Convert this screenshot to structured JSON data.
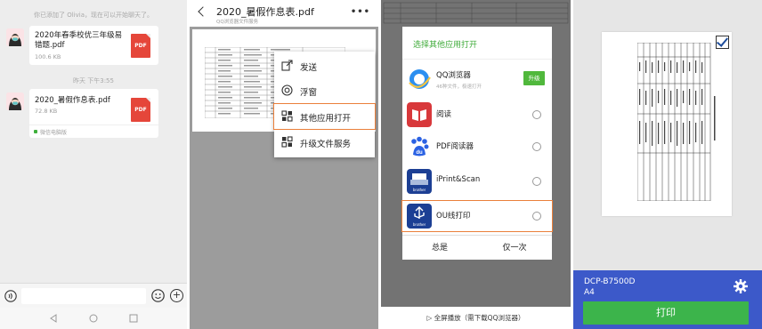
{
  "chat": {
    "system_message": "你已添加了 Olivia，现在可以开始聊天了。",
    "timestamp": "昨天 下午3:55",
    "messages": [
      {
        "file_name": "2020年春季校优三年级易错题.pdf",
        "file_size": "100.6 KB",
        "file_type": "PDF"
      },
      {
        "file_name": "2020_暑假作息表.pdf",
        "file_size": "72.8 KB",
        "file_type": "PDF",
        "source": "微信电脑版"
      }
    ]
  },
  "viewer": {
    "title": "2020_暑假作息表.pdf",
    "subtitle": "QQ浏览器文件服务",
    "more_icon": "more-dots-icon",
    "menu": [
      {
        "label": "发送",
        "icon": "send-icon"
      },
      {
        "label": "浮窗",
        "icon": "float-window-icon"
      },
      {
        "label": "其他应用打开",
        "icon": "apps-grid-icon",
        "highlighted": true
      },
      {
        "label": "升级文件服务",
        "icon": "upgrade-icon"
      }
    ]
  },
  "chooser": {
    "title": "选择其他应用打开",
    "apps": [
      {
        "name": "QQ浏览器",
        "subtitle": "46种文件，极速打开",
        "action": "升级"
      },
      {
        "name": "阅读"
      },
      {
        "name": "PDF阅读器"
      },
      {
        "name": "iPrint&Scan",
        "brand": "brother"
      },
      {
        "name": "OU线打印",
        "brand": "brother",
        "highlighted": true
      }
    ],
    "always_label": "总是",
    "once_label": "仅一次",
    "bottom_text": "全屏播放（需下载QQ浏览器）"
  },
  "print": {
    "printer_name": "DCP-B7500D",
    "paper_size": "A4",
    "print_label": "打印"
  },
  "colors": {
    "accent_green": "#3cb44b",
    "highlight_orange": "#ea7f3a",
    "print_blue": "#3c59c9",
    "pdf_red": "#e5463a"
  }
}
